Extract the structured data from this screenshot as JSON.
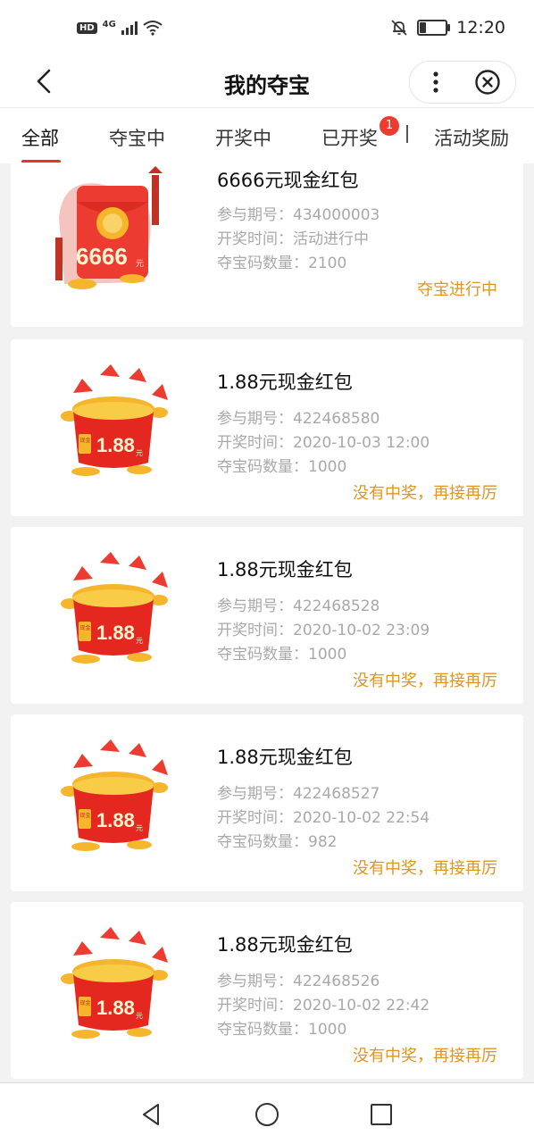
{
  "status_bar": {
    "left_badges": [
      "HD",
      "4G"
    ],
    "time": "12:20",
    "battery_level": 0.25,
    "icons": [
      "signal-icon",
      "wifi-icon",
      "mute-bell-icon",
      "battery-icon"
    ]
  },
  "header": {
    "title": "我的夺宝",
    "icons": [
      "back-chevron-icon",
      "more-dots-icon",
      "close-circle-icon"
    ]
  },
  "tabs": [
    {
      "label": "全部",
      "active": true
    },
    {
      "label": "夺宝中"
    },
    {
      "label": "开奖中"
    },
    {
      "label": "已开奖",
      "badge": "1"
    },
    {
      "label": "活动奖励"
    }
  ],
  "items": [
    {
      "title": "6666元现金红包",
      "period_label": "参与期号：",
      "period": "434000003",
      "time_label": "开奖时间：",
      "time": "活动进行中",
      "count_label": "夺宝码数量：",
      "count": "2100",
      "status": "夺宝进行中",
      "thumb_text": "6666",
      "thumb_unit": "元"
    },
    {
      "title": "1.88元现金红包",
      "period_label": "参与期号：",
      "period": "422468580",
      "time_label": "开奖时间：",
      "time": "2020-10-03 12:00",
      "count_label": "夺宝码数量：",
      "count": "1000",
      "status": "没有中奖，再接再厉",
      "thumb_text": "1.88",
      "thumb_tag": "现金",
      "thumb_unit": "元"
    },
    {
      "title": "1.88元现金红包",
      "period_label": "参与期号：",
      "period": "422468528",
      "time_label": "开奖时间：",
      "time": "2020-10-02 23:09",
      "count_label": "夺宝码数量：",
      "count": "1000",
      "status": "没有中奖，再接再厉",
      "thumb_text": "1.88",
      "thumb_tag": "现金",
      "thumb_unit": "元"
    },
    {
      "title": "1.88元现金红包",
      "period_label": "参与期号：",
      "period": "422468527",
      "time_label": "开奖时间：",
      "time": "2020-10-02 22:54",
      "count_label": "夺宝码数量：",
      "count": "982",
      "status": "没有中奖，再接再厉",
      "thumb_text": "1.88",
      "thumb_tag": "现金",
      "thumb_unit": "元"
    },
    {
      "title": "1.88元现金红包",
      "period_label": "参与期号：",
      "period": "422468526",
      "time_label": "开奖时间：",
      "time": "2020-10-02 22:42",
      "count_label": "夺宝码数量：",
      "count": "1000",
      "status": "没有中奖，再接再厉",
      "thumb_text": "1.88",
      "thumb_tag": "现金",
      "thumb_unit": "元"
    }
  ],
  "nav_bar": {
    "icons": [
      "nav-back-icon",
      "nav-home-icon",
      "nav-recents-icon"
    ]
  },
  "colors": {
    "accent": "#e2362a",
    "status": "#e0951e",
    "meta": "#a9a9a9",
    "badge": "#ee3b2f"
  }
}
